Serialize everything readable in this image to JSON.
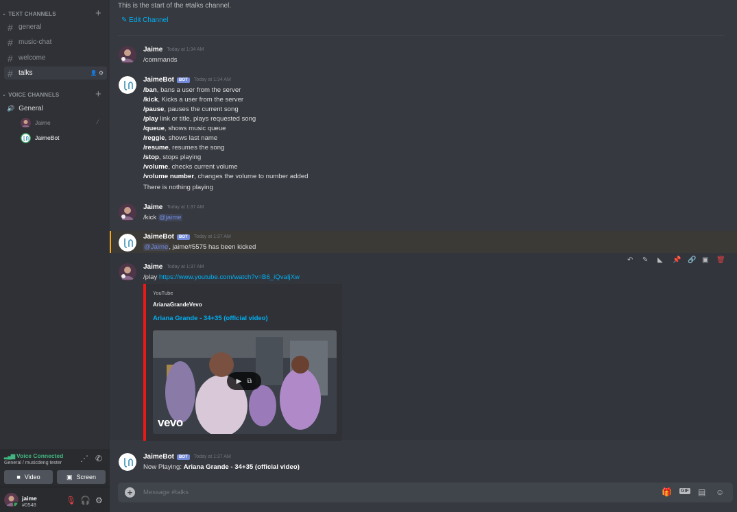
{
  "sidebar": {
    "text_channels_label": "TEXT CHANNELS",
    "text_channels": [
      "general",
      "music-chat",
      "welcome",
      "talks"
    ],
    "voice_channels_label": "VOICE CHANNELS",
    "voice_channel": "General",
    "voice_users": [
      "Jaime",
      "JaimeBot"
    ]
  },
  "voice_panel": {
    "status": "Voice Connected",
    "sub": "General / musicdeng tester",
    "video_label": "Video",
    "screen_label": "Screen"
  },
  "user_panel": {
    "name": "jaime",
    "tag": "#0548"
  },
  "channel": {
    "intro": "This is the start of the #talks channel.",
    "edit_label": "Edit Channel"
  },
  "bot_badge": "BOT",
  "messages": [
    {
      "author": "Jaime",
      "time": "Today at 1:34 AM",
      "text": "/commands"
    },
    {
      "author": "JaimeBot",
      "time": "Today at 1:34 AM",
      "lines": [
        {
          "cmd": "/ban",
          "rest": ", bans a user from the server"
        },
        {
          "cmd": "/kick",
          "rest": ", Kicks a user from the server"
        },
        {
          "cmd": "/pause",
          "rest": ", pauses the current song"
        },
        {
          "cmd": "/play",
          "rest": " link or title, plays requested song"
        },
        {
          "cmd": "/queue",
          "rest": ", shows music queue"
        },
        {
          "cmd": "/reggie",
          "rest": ", shows last name"
        },
        {
          "cmd": "/resume",
          "rest": ", resumes the song"
        },
        {
          "cmd": "/stop",
          "rest": ", stops playing"
        },
        {
          "cmd": "/volume",
          "rest": ", checks current volume"
        },
        {
          "cmd": "/volume number",
          "rest": ", changes the volume to number added"
        }
      ],
      "footer": "There is nothing playing"
    },
    {
      "author": "Jaime",
      "time": "Today at 1:37 AM",
      "text": "/kick",
      "mention": "@jaime"
    },
    {
      "author": "JaimeBot",
      "time": "Today at 1:37 AM",
      "mention": "@Jaime",
      "text": ", jaime#5575  has been kicked"
    },
    {
      "author": "Jaime",
      "time": "Today at 1:37 AM",
      "text": "/play",
      "link": "https://www.youtube.com/watch?v=B6_iQvaIjXw",
      "embed": {
        "provider": "YouTube",
        "author": "ArianaGrandeVevo",
        "title": "Ariana Grande - 34+35 (official video)",
        "watermark": "vevo"
      }
    },
    {
      "author": "JaimeBot",
      "time": "Today at 1:37 AM",
      "prefix": "Now Playing: ",
      "bold": "Ariana Grande - 34+35 (official video)"
    }
  ],
  "composer": {
    "placeholder": "Message #talks",
    "gif_label": "GIF"
  },
  "colors": {
    "accent": "#00b0f4",
    "voice_green": "#43b581",
    "embed_bar": "#e91916",
    "bot_badge": "#7289da"
  }
}
